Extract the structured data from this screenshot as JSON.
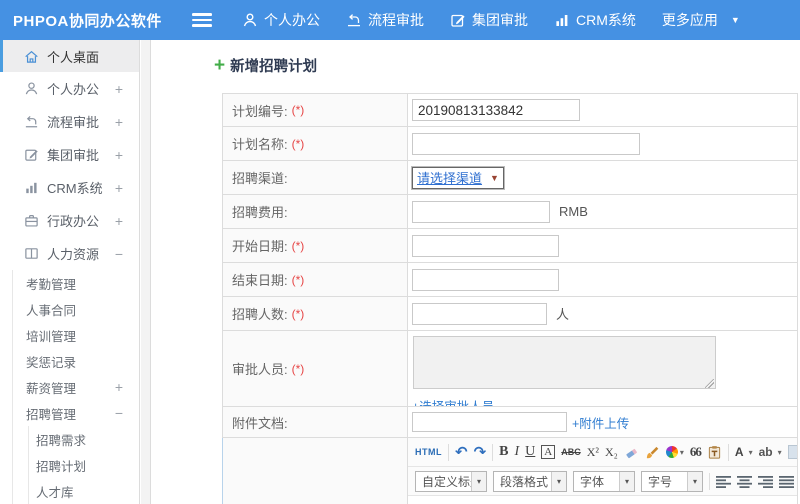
{
  "colors": {
    "header_bg": "#4591e3",
    "accent_blue": "#4a9de0",
    "link_blue": "#2f7cd0",
    "required_red": "#e64545",
    "title_navy": "#2f3b52",
    "plus_green": "#43ad49"
  },
  "icons": {
    "plus": "+",
    "caret_down": "▼",
    "caret_small": "▾",
    "undo": "↶",
    "redo": "↷"
  },
  "header": {
    "logo": "PHPOA协同办公软件",
    "nav": [
      {
        "label": "个人办公"
      },
      {
        "label": "流程审批"
      },
      {
        "label": "集团审批"
      },
      {
        "label": "CRM系统"
      },
      {
        "label": "更多应用"
      }
    ]
  },
  "sidebar": {
    "items": [
      {
        "label": "个人桌面",
        "sign": ""
      },
      {
        "label": "个人办公",
        "sign": "+"
      },
      {
        "label": "流程审批",
        "sign": "+"
      },
      {
        "label": "集团审批",
        "sign": "+"
      },
      {
        "label": "CRM系统",
        "sign": "+"
      },
      {
        "label": "行政办公",
        "sign": "+"
      },
      {
        "label": "人力资源",
        "sign": "−"
      }
    ],
    "hr_submenu": [
      {
        "label": "考勤管理",
        "sign": ""
      },
      {
        "label": "人事合同",
        "sign": ""
      },
      {
        "label": "培训管理",
        "sign": ""
      },
      {
        "label": "奖惩记录",
        "sign": ""
      },
      {
        "label": "薪资管理",
        "sign": "+"
      },
      {
        "label": "招聘管理",
        "sign": "−"
      }
    ],
    "recruit_submenu": [
      {
        "label": "招聘需求"
      },
      {
        "label": "招聘计划"
      },
      {
        "label": "人才库"
      }
    ]
  },
  "main": {
    "page_title": "新增招聘计划",
    "form": {
      "rows": [
        {
          "label": "计划编号:",
          "req": "(*)",
          "value": "20190813133842"
        },
        {
          "label": "计划名称:",
          "req": "(*)"
        },
        {
          "label": "招聘渠道:",
          "req": "",
          "select": "请选择渠道"
        },
        {
          "label": "招聘费用:",
          "req": "",
          "suffix": "RMB"
        },
        {
          "label": "开始日期:",
          "req": "(*)"
        },
        {
          "label": "结束日期:",
          "req": "(*)"
        },
        {
          "label": "招聘人数:",
          "req": "(*)",
          "suffix": "人"
        },
        {
          "label": "审批人员:",
          "req": "(*)",
          "link": "+选择审批人员"
        },
        {
          "label": "附件文档:",
          "req": "",
          "link": "+附件上传"
        }
      ]
    },
    "editor": {
      "buttons": {
        "html": "HTML",
        "bold": "B",
        "italic": "I",
        "underline": "U",
        "font_box": "A",
        "strike": "ABC",
        "sup": "X²",
        "sub": "X₂",
        "quote": "66",
        "fore": "A",
        "back": "ab"
      },
      "dropdowns": [
        "自定义标题",
        "段落格式",
        "字体",
        "字号"
      ]
    }
  }
}
